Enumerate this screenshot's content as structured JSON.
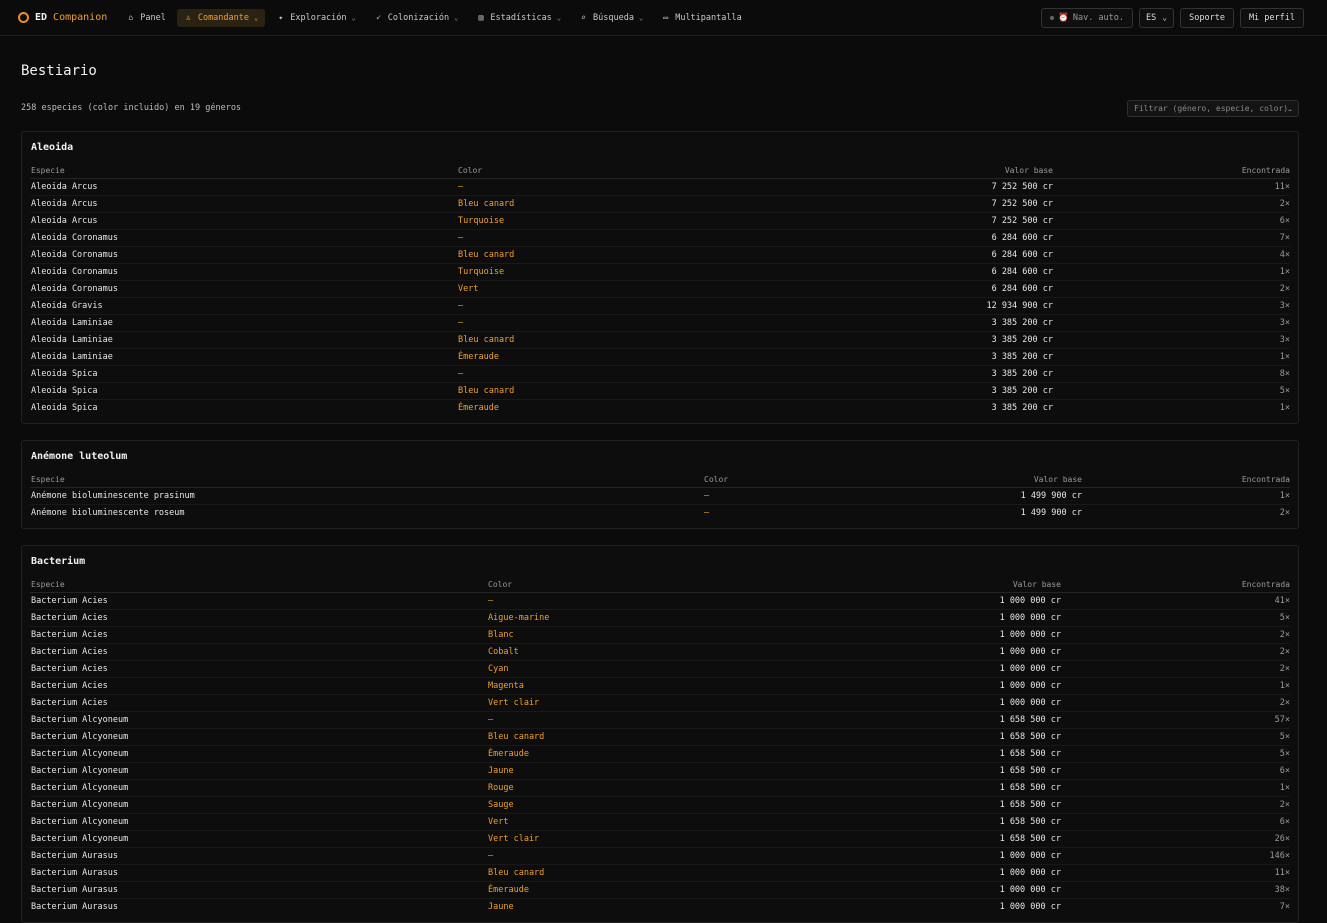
{
  "brand": {
    "ed": "ED",
    "companion": "Companion"
  },
  "nav": [
    {
      "icon": "home-icon",
      "glyph": "⌂",
      "label": "Panel",
      "chevron": false,
      "active": false
    },
    {
      "icon": "commander-icon",
      "glyph": "♙",
      "label": "Comandante",
      "chevron": true,
      "active": true
    },
    {
      "icon": "telescope-icon",
      "glyph": "✦",
      "label": "Exploración",
      "chevron": true,
      "active": false
    },
    {
      "icon": "rocket-icon",
      "glyph": "➶",
      "label": "Colonización",
      "chevron": true,
      "active": false
    },
    {
      "icon": "chart-icon",
      "glyph": "▥",
      "label": "Estadísticas",
      "chevron": true,
      "active": false
    },
    {
      "icon": "search-icon",
      "glyph": "⌕",
      "label": "Búsqueda",
      "chevron": true,
      "active": false
    },
    {
      "icon": "monitor-icon",
      "glyph": "▭",
      "label": "Multipantalla",
      "chevron": false,
      "active": false
    }
  ],
  "topright": {
    "nav_auto": "Nav. auto.",
    "lang": "ES",
    "support": "Soporte",
    "profile": "Mi perfil"
  },
  "page": {
    "title": "Bestiario",
    "summary": "258 especies (color incluido) en 19 géneros",
    "filter_placeholder": "Filtrar (género, especie, color)…"
  },
  "columns": {
    "species": "Especie",
    "color": "Color",
    "value": "Valor base",
    "found": "Encontrada"
  },
  "groups": [
    {
      "name": "Aleoida",
      "colw": [
        "427px",
        "auto",
        "auto",
        "237px"
      ],
      "rows": [
        [
          "Aleoida Arcus",
          "—",
          "7 252 500 cr",
          "11×"
        ],
        [
          "Aleoida Arcus",
          "Bleu canard",
          "7 252 500 cr",
          "2×"
        ],
        [
          "Aleoida Arcus",
          "Turquoise",
          "7 252 500 cr",
          "6×"
        ],
        [
          "Aleoida Coronamus",
          "—",
          "6 284 600 cr",
          "7×"
        ],
        [
          "Aleoida Coronamus",
          "Bleu canard",
          "6 284 600 cr",
          "4×"
        ],
        [
          "Aleoida Coronamus",
          "Turquoise",
          "6 284 600 cr",
          "1×"
        ],
        [
          "Aleoida Coronamus",
          "Vert",
          "6 284 600 cr",
          "2×"
        ],
        [
          "Aleoida Gravis",
          "—",
          "12 934 900 cr",
          "3×"
        ],
        [
          "Aleoida Laminiae",
          "—",
          "3 385 200 cr",
          "3×"
        ],
        [
          "Aleoida Laminiae",
          "Bleu canard",
          "3 385 200 cr",
          "3×"
        ],
        [
          "Aleoida Laminiae",
          "Émeraude",
          "3 385 200 cr",
          "1×"
        ],
        [
          "Aleoida Spica",
          "—",
          "3 385 200 cr",
          "8×"
        ],
        [
          "Aleoida Spica",
          "Bleu canard",
          "3 385 200 cr",
          "5×"
        ],
        [
          "Aleoida Spica",
          "Émeraude",
          "3 385 200 cr",
          "1×"
        ]
      ]
    },
    {
      "name": "Anémone luteolum",
      "colw": [
        "673px",
        "auto",
        "auto",
        "208px"
      ],
      "rows": [
        [
          "Anémone bioluminescente prasinum",
          "—",
          "1 499 900 cr",
          "1×"
        ],
        [
          "Anémone bioluminescente roseum",
          "—",
          "1 499 900 cr",
          "2×"
        ]
      ]
    },
    {
      "name": "Bacterium",
      "colw": [
        "457px",
        "auto",
        "auto",
        "229px"
      ],
      "rows": [
        [
          "Bacterium Acies",
          "—",
          "1 000 000 cr",
          "41×"
        ],
        [
          "Bacterium Acies",
          "Aigue-marine",
          "1 000 000 cr",
          "5×"
        ],
        [
          "Bacterium Acies",
          "Blanc",
          "1 000 000 cr",
          "2×"
        ],
        [
          "Bacterium Acies",
          "Cobalt",
          "1 000 000 cr",
          "2×"
        ],
        [
          "Bacterium Acies",
          "Cyan",
          "1 000 000 cr",
          "2×"
        ],
        [
          "Bacterium Acies",
          "Magenta",
          "1 000 000 cr",
          "1×"
        ],
        [
          "Bacterium Acies",
          "Vert clair",
          "1 000 000 cr",
          "2×"
        ],
        [
          "Bacterium Alcyoneum",
          "—",
          "1 658 500 cr",
          "57×"
        ],
        [
          "Bacterium Alcyoneum",
          "Bleu canard",
          "1 658 500 cr",
          "5×"
        ],
        [
          "Bacterium Alcyoneum",
          "Émeraude",
          "1 658 500 cr",
          "5×"
        ],
        [
          "Bacterium Alcyoneum",
          "Jaune",
          "1 658 500 cr",
          "6×"
        ],
        [
          "Bacterium Alcyoneum",
          "Rouge",
          "1 658 500 cr",
          "1×"
        ],
        [
          "Bacterium Alcyoneum",
          "Sauge",
          "1 658 500 cr",
          "2×"
        ],
        [
          "Bacterium Alcyoneum",
          "Vert",
          "1 658 500 cr",
          "6×"
        ],
        [
          "Bacterium Alcyoneum",
          "Vert clair",
          "1 658 500 cr",
          "26×"
        ],
        [
          "Bacterium Aurasus",
          "—",
          "1 000 000 cr",
          "146×"
        ],
        [
          "Bacterium Aurasus",
          "Bleu canard",
          "1 000 000 cr",
          "11×"
        ],
        [
          "Bacterium Aurasus",
          "Émeraude",
          "1 000 000 cr",
          "38×"
        ],
        [
          "Bacterium Aurasus",
          "Jaune",
          "1 000 000 cr",
          "7×"
        ]
      ]
    }
  ]
}
